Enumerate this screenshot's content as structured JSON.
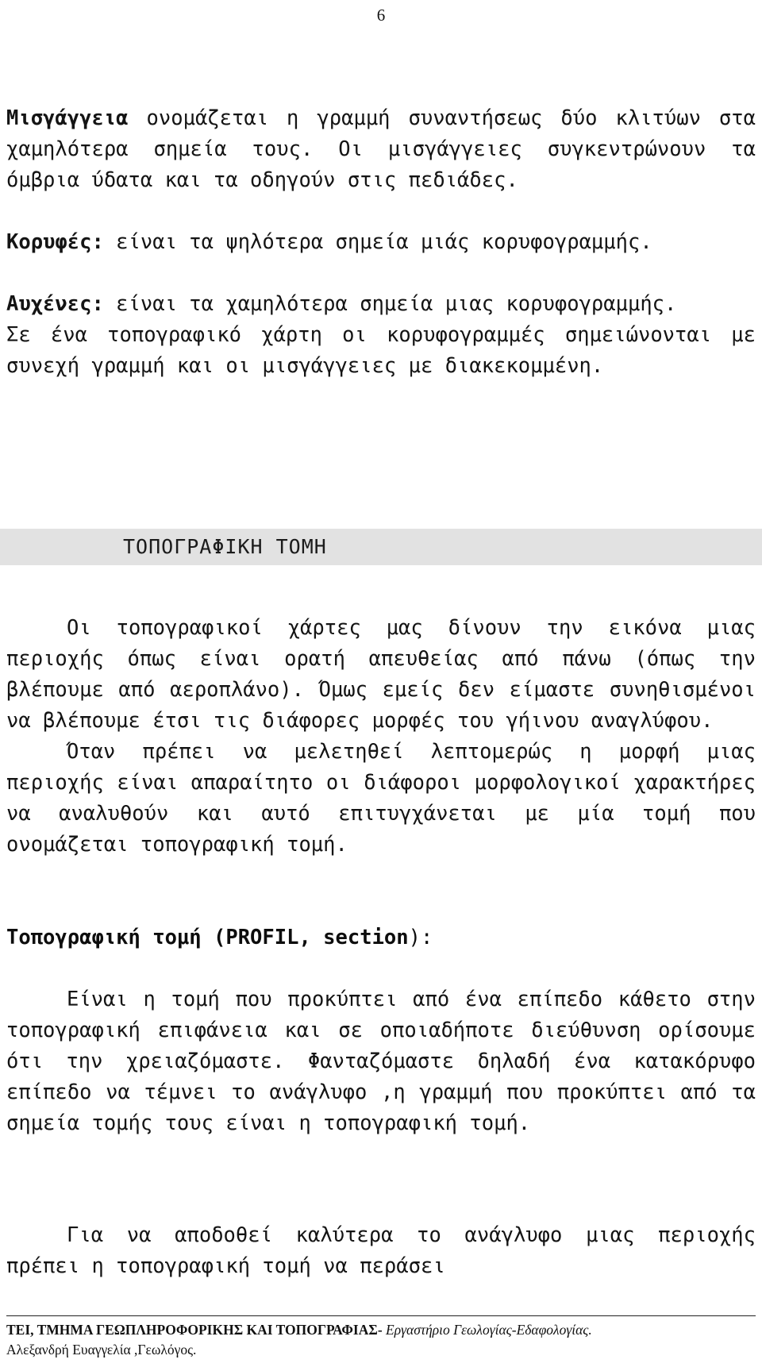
{
  "page": {
    "number": "6"
  },
  "body": {
    "paragraph_1": {
      "lead": "Μισγάγγεια",
      "text": " ονομάζεται η γραμμή συναντήσεως δύο κλιτύων στα χαμηλότερα σημεία τους. Οι μισγάγγειες συγκεντρώνουν τα όμβρια ύδατα και τα οδηγούν στις πεδιάδες."
    },
    "paragraph_2": {
      "lead": "Κορυφές:",
      "text": " είναι τα ψηλότερα σημεία μιάς κορυφογραμμής."
    },
    "paragraph_3": {
      "lead": "Αυχένες:",
      "text": " είναι τα χαμηλότερα σημεία μιας κορυφογραμμής."
    },
    "paragraph_4": {
      "text": "Σε ένα τοπογραφικό χάρτη οι κορυφογραμμές σημειώνονται με συνεχή γραμμή και οι μισγάγγειες με διακεκομμένη."
    },
    "section_heading": "ΤΟΠΟΓΡΑΦΙΚΗ ΤΟΜΗ",
    "paragraph_5": {
      "text": "Οι τοπογραφικοί χάρτες μας δίνουν την εικόνα μιας περιοχής όπως είναι ορατή απευθείας από πάνω (όπως την βλέπουμε από αεροπλάνο). Όμως εμείς δεν είμαστε συνηθισμένοι να βλέπουμε έτσι τις διάφορες μορφές του γήινου αναγλύφου."
    },
    "paragraph_6": {
      "text": "Όταν πρέπει να μελετηθεί λεπτομερώς η μορφή μιας περιοχής είναι απαραίτητο οι διάφοροι μορφολογικοί χαρακτήρες να αναλυθούν και αυτό επιτυγχάνεται με μία   τομή που ονομάζεται τοπογραφική τομή."
    },
    "paragraph_7_heading": {
      "bold": "Τοπογραφική τομή (PROFIL, section",
      "light": "):"
    },
    "paragraph_8": {
      "text": "Είναι η τομή που προκύπτει από ένα επίπεδο κάθετο στην τοπογραφική επιφάνεια και σε οποιαδήποτε διεύθυνση ορίσουμε ότι την χρειαζόμαστε. Φανταζόμαστε δηλαδή ένα κατακόρυφο επίπεδο να τέμνει το ανάγλυφο ,η γραμμή που προκύπτει από τα σημεία τομής τους είναι η τοπογραφική τομή."
    },
    "paragraph_9": {
      "text": "Για να αποδοθεί καλύτερα το ανάγλυφο μιας περιοχής πρέπει η τοπογραφική τομή να περάσει"
    }
  },
  "footer": {
    "line_1_bold": "ΤΕΙ, ΤΜΗΜΑ ΓΕΩΠΛΗΡΟΦΟΡΙΚΗΣ ΚΑΙ ΤΟΠΟΓΡΑΦΙΑΣ-",
    "line_1_rest": " Εργαστήριο Γεωλογίας-Εδαφολογίας.",
    "line_2": "Αλεξανδρή Ευαγγελία ,Γεωλόγος."
  }
}
